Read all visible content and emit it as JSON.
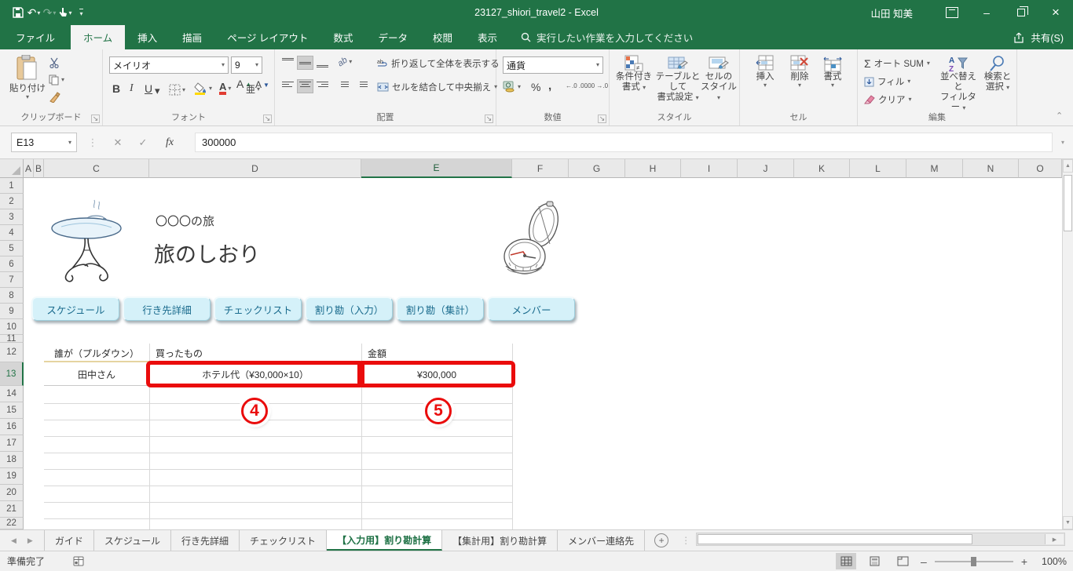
{
  "glyphs": {
    "dropdown": "▾",
    "undo": "↶",
    "redo": "↷",
    "close": "×",
    "minimize": "–",
    "ellipsis_v": "⋮",
    "left": "◀",
    "right": "▶",
    "up": "▲",
    "down": "▼",
    "plus": "+",
    "minus": "–",
    "launcher": "↘",
    "collapse": "⌃",
    "cancel": "✕",
    "enter": "✓",
    "sigma": "Σ",
    "grow_font": "A",
    "shrink_font": "A"
  },
  "titlebar": {
    "title": "23127_shiori_travel2 - Excel",
    "user": "山田 知美"
  },
  "ribbon_tabs": {
    "file": "ファイル",
    "home": "ホーム",
    "insert": "挿入",
    "draw": "描画",
    "layout": "ページ レイアウト",
    "formulas": "数式",
    "data": "データ",
    "review": "校閲",
    "view": "表示"
  },
  "tellme": {
    "placeholder": "実行したい作業を入力してください"
  },
  "share": {
    "label": "共有(S)"
  },
  "ribbon": {
    "clipboard": {
      "paste": "貼り付け",
      "label": "クリップボード"
    },
    "font": {
      "name": "メイリオ",
      "size": "9",
      "bold": "B",
      "italic": "I",
      "underline": "U",
      "phonetic": "亜",
      "label": "フォント"
    },
    "alignment": {
      "wrap": "折り返して全体を表示する",
      "merge": "セルを結合して中央揃え",
      "orient": "ab",
      "label": "配置"
    },
    "number": {
      "format": "通貨",
      "percent": "%",
      "comma": ",",
      "inc_decimal": "←.0 .00",
      "dec_decimal": ".00 →.0",
      "label": "数値"
    },
    "styles": {
      "conditional1": "条件付き",
      "conditional2": "書式",
      "table1": "テーブルとして",
      "table2": "書式設定",
      "cell1": "セルの",
      "cell2": "スタイル",
      "label": "スタイル"
    },
    "cells": {
      "insert": "挿入",
      "delete": "削除",
      "format": "書式",
      "label": "セル"
    },
    "editing": {
      "autosum": "オート SUM",
      "fill": "フィル",
      "clear": "クリア",
      "sort1": "並べ替えと",
      "sort2": "フィルター",
      "find1": "検索と",
      "find2": "選択",
      "label": "編集"
    }
  },
  "formula_bar": {
    "name_box": "E13",
    "fx": "fx",
    "value": "300000"
  },
  "grid": {
    "columns": [
      "A",
      "B",
      "C",
      "D",
      "E",
      "F",
      "G",
      "H",
      "I",
      "J",
      "K",
      "L",
      "M",
      "N",
      "O"
    ],
    "selected_column": "E",
    "rows": [
      "1",
      "2",
      "3",
      "4",
      "5",
      "6",
      "7",
      "8",
      "9",
      "10",
      "11",
      "12",
      "13",
      "14",
      "15",
      "16",
      "17",
      "18",
      "19",
      "20",
      "21",
      "22"
    ],
    "selected_row": "13"
  },
  "sheet": {
    "trip_label": "〇〇〇の旅",
    "trip_title": "旅のしおり",
    "nav_buttons": [
      "スケジュール",
      "行き先詳細",
      "チェックリスト",
      "割り勘（入力）",
      "割り勘（集計）",
      "メンバー"
    ],
    "table": {
      "headers": [
        "誰が（プルダウン）",
        "買ったもの",
        "金額"
      ],
      "row": [
        "田中さん",
        "ホテル代（¥30,000×10）",
        "¥300,000"
      ]
    },
    "annotations": [
      "4",
      "5"
    ]
  },
  "sheet_tabs": {
    "tabs": [
      "ガイド",
      "スケジュール",
      "行き先詳細",
      "チェックリスト",
      "【入力用】割り勘計算",
      "【集計用】割り勘計算",
      "メンバー連絡先"
    ],
    "active": "【入力用】割り勘計算"
  },
  "status_bar": {
    "ready": "準備完了",
    "zoom": "100%"
  }
}
